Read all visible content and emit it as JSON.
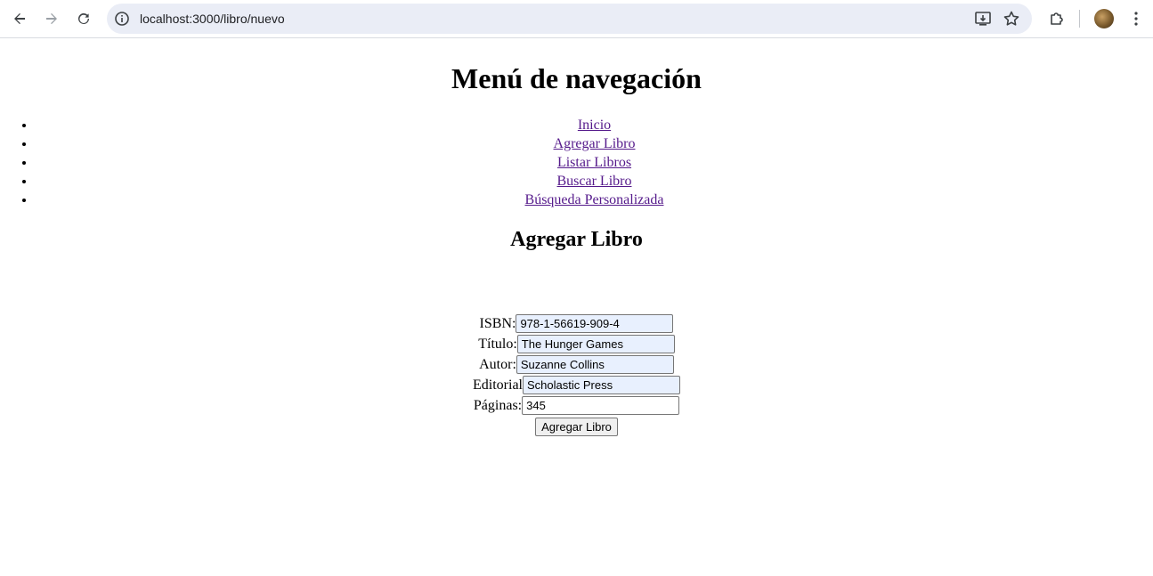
{
  "browser": {
    "url": "localhost:3000/libro/nuevo",
    "icons": [
      "back-arrow-icon",
      "forward-arrow-icon",
      "reload-icon",
      "site-info-icon",
      "install-app-icon",
      "bookmark-star-icon",
      "extensions-icon",
      "profile-avatar",
      "menu-kebab-icon"
    ]
  },
  "page": {
    "title": "Menú de navegación",
    "menu": [
      {
        "label": "Inicio"
      },
      {
        "label": "Agregar Libro"
      },
      {
        "label": "Listar Libros"
      },
      {
        "label": "Buscar Libro"
      },
      {
        "label": "Búsqueda Personalizada"
      }
    ],
    "form_title": "Agregar Libro",
    "fields": {
      "isbn": {
        "label": "ISBN:",
        "value": "978-1-56619-909-4"
      },
      "titulo": {
        "label": "Título:",
        "value": "The Hunger Games"
      },
      "autor": {
        "label": "Autor:",
        "value": "Suzanne Collins"
      },
      "editorial": {
        "label": "Editorial",
        "value": "Scholastic Press"
      },
      "paginas": {
        "label": "Páginas:",
        "value": "345"
      }
    },
    "submit_label": "Agregar Libro"
  },
  "colors": {
    "omnibox_bg": "#eaedf6",
    "link_visited": "#551a8b",
    "autofill_bg": "#e8f0fe"
  }
}
